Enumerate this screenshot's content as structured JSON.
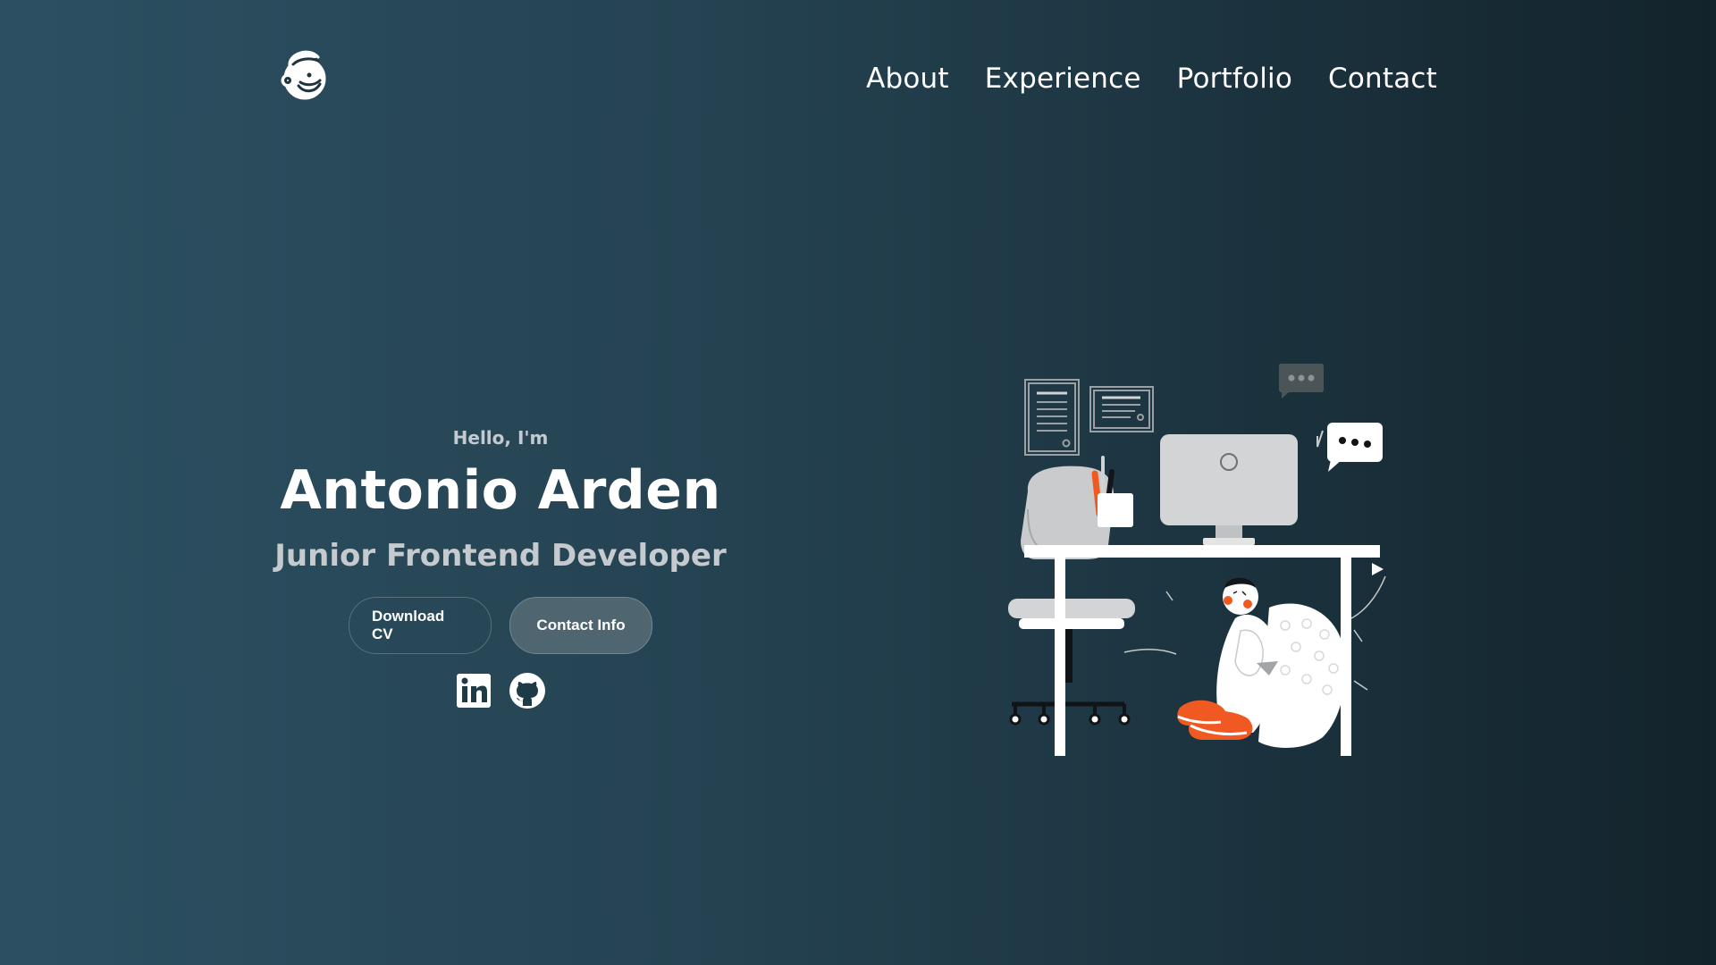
{
  "nav": {
    "items": [
      {
        "label": "About"
      },
      {
        "label": "Experience"
      },
      {
        "label": "Portfolio"
      },
      {
        "label": "Contact"
      }
    ]
  },
  "hero": {
    "greeting": "Hello, I'm",
    "name": "Antonio Arden",
    "role": "Junior Frontend Developer",
    "buttons": {
      "download_cv": "Download CV",
      "contact_info": "Contact Info"
    },
    "socials": [
      {
        "icon": "linkedin-icon"
      },
      {
        "icon": "github-icon"
      }
    ]
  },
  "colors": {
    "bg_left": "#2c5062",
    "bg_right": "#13232b",
    "accent_orange": "#f05a22",
    "text_muted": "#c4cacd"
  }
}
